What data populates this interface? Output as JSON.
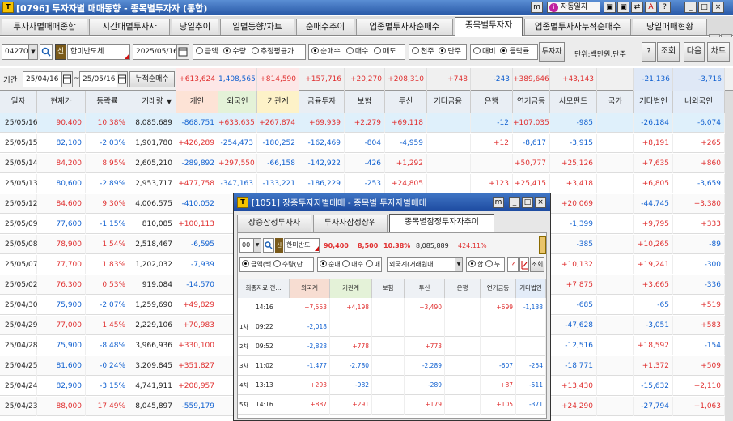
{
  "window": {
    "title": "[0796] 투자자별 매매동향 - 종목별투자자 (통합)",
    "icon": "T",
    "auto_journal": "자동일지",
    "ctrl_buttons": [
      "m",
      "▣",
      "▣",
      "⇄",
      "A",
      "?",
      "_",
      "□",
      "×"
    ]
  },
  "tabs": [
    "투자자별매매종합",
    "시간대별투자자",
    "당일추이",
    "일별동향/차트",
    "순매수추이",
    "업종별투자자순매수",
    "종목별투자자",
    "업종별투자자누적순매수",
    "당일매매현황"
  ],
  "tab_active": "종목별투자자",
  "tab_nav": [
    "◀",
    "▶"
  ],
  "toolbar": {
    "code": "042700",
    "stock_name": "한미반도체",
    "date": "2025/05/16",
    "amount_opts": [
      "금액",
      "수량",
      "추정평균가"
    ],
    "amount_sel": "수량",
    "buy_opts": [
      "순매수",
      "매수",
      "매도"
    ],
    "buy_sel": "순매수",
    "unit_opts": [
      "천주",
      "단주"
    ],
    "unit_sel": "단주",
    "cmp_opts": [
      "대비",
      "등락률"
    ],
    "cmp_sel": "등락률",
    "investor": "투자자",
    "unit_text": "단위:백만원,단주",
    "help": "?",
    "query": "조회",
    "next": "다음",
    "chart": "차트"
  },
  "period": {
    "label": "기간",
    "from": "25/04/16",
    "to": "25/05/16",
    "sep": "~",
    "accum": "누적순매수"
  },
  "summary": [
    "+613,624",
    "1,408,565",
    "+814,590",
    "+157,716",
    "+20,270",
    "+208,310",
    "+748",
    "-243",
    "+389,646",
    "+43,143",
    "",
    "-21,136",
    "-3,716"
  ],
  "headers": [
    "일자",
    "현재가",
    "등락률",
    "거래량",
    "개인",
    "외국인",
    "기관계",
    "금융투자",
    "보험",
    "투신",
    "기타금융",
    "은행",
    "연기금등",
    "사모펀드",
    "국가",
    "기타법인",
    "내외국인"
  ],
  "sort_arrow": "▼",
  "rows": [
    {
      "d": "25/05/16",
      "p": "90,400",
      "r": "10.38%",
      "v": "8,085,689",
      "c": [
        "-868,751",
        "+633,635",
        "+267,874",
        "+69,939",
        "+2,279",
        "+69,118",
        "",
        "-12",
        "+107,035",
        "-985",
        "",
        "-26,184",
        "-6,074"
      ]
    },
    {
      "d": "25/05/15",
      "p": "82,100",
      "r": "-2.03%",
      "v": "1,901,780",
      "c": [
        "+426,289",
        "-254,473",
        "-180,252",
        "-162,469",
        "-804",
        "-4,959",
        "",
        "+12",
        "-8,617",
        "-3,915",
        "",
        "+8,191",
        "+265"
      ]
    },
    {
      "d": "25/05/14",
      "p": "84,200",
      "r": "8.95%",
      "v": "2,605,210",
      "c": [
        "-289,892",
        "+297,550",
        "-66,158",
        "-142,922",
        "-426",
        "+1,292",
        "",
        "",
        "+50,777",
        "+25,126",
        "",
        "+7,635",
        "+860"
      ]
    },
    {
      "d": "25/05/13",
      "p": "80,600",
      "r": "-2.89%",
      "v": "2,953,717",
      "c": [
        "+477,758",
        "-347,163",
        "-133,221",
        "-186,229",
        "-253",
        "+24,805",
        "",
        "+123",
        "+25,415",
        "+3,418",
        "",
        "+6,805",
        "-3,659"
      ]
    },
    {
      "d": "25/05/12",
      "p": "84,600",
      "r": "9.30%",
      "v": "4,006,575",
      "c": [
        "-410,052",
        "+2",
        "",
        "",
        "",
        "",
        "",
        "",
        "",
        "+20,069",
        "",
        "-44,745",
        "+3,380"
      ]
    },
    {
      "d": "25/05/09",
      "p": "77,600",
      "r": "-1.15%",
      "v": "810,085",
      "c": [
        "+100,113",
        "",
        "",
        "",
        "",
        "",
        "",
        "",
        "",
        "-1,399",
        "",
        "+9,795",
        "+333"
      ]
    },
    {
      "d": "25/05/08",
      "p": "78,900",
      "r": "1.54%",
      "v": "2,518,467",
      "c": [
        "-6,595",
        "",
        "",
        "",
        "",
        "",
        "",
        "",
        "",
        "-385",
        "",
        "+10,265",
        "-89"
      ]
    },
    {
      "d": "25/05/07",
      "p": "77,700",
      "r": "1.83%",
      "v": "1,202,032",
      "c": [
        "-7,939",
        "",
        "",
        "",
        "",
        "",
        "",
        "",
        "",
        "+10,132",
        "",
        "+19,241",
        "-300"
      ]
    },
    {
      "d": "25/05/02",
      "p": "76,300",
      "r": "0.53%",
      "v": "919,084",
      "c": [
        "-14,570",
        "",
        "",
        "",
        "",
        "",
        "",
        "",
        "",
        "+7,875",
        "",
        "+3,665",
        "-336"
      ]
    },
    {
      "d": "25/04/30",
      "p": "75,900",
      "r": "-2.07%",
      "v": "1,259,690",
      "c": [
        "+49,829",
        "",
        "",
        "",
        "",
        "",
        "",
        "",
        "",
        "-685",
        "",
        "-65",
        "+519"
      ]
    },
    {
      "d": "25/04/29",
      "p": "77,000",
      "r": "1.45%",
      "v": "2,229,106",
      "c": [
        "+70,983",
        "",
        "",
        "",
        "",
        "",
        "",
        "",
        "",
        "-47,628",
        "",
        "-3,051",
        "+583"
      ]
    },
    {
      "d": "25/04/28",
      "p": "75,900",
      "r": "-8.48%",
      "v": "3,966,936",
      "c": [
        "+330,100",
        "",
        "",
        "",
        "",
        "",
        "",
        "",
        "",
        "-12,516",
        "",
        "+18,592",
        "-154"
      ]
    },
    {
      "d": "25/04/25",
      "p": "81,600",
      "r": "-0.24%",
      "v": "3,209,845",
      "c": [
        "+351,827",
        "",
        "",
        "",
        "",
        "",
        "",
        "",
        "",
        "-18,771",
        "",
        "+1,372",
        "+509"
      ]
    },
    {
      "d": "25/04/24",
      "p": "82,900",
      "r": "-3.15%",
      "v": "4,741,911",
      "c": [
        "+208,957",
        "",
        "",
        "",
        "",
        "",
        "",
        "",
        "",
        "+13,430",
        "",
        "-15,632",
        "+2,110"
      ]
    },
    {
      "d": "25/04/23",
      "p": "88,000",
      "r": "17.49%",
      "v": "8,045,897",
      "c": [
        "-559,179",
        "",
        "",
        "",
        "",
        "",
        "",
        "",
        "",
        "+24,290",
        "",
        "-27,794",
        "+1,063"
      ]
    }
  ],
  "popup": {
    "title": "[1051] 장중투자자별매매 - 종목별 투자자별매매",
    "icon": "T",
    "buttons": [
      "m",
      "_",
      "□",
      "×"
    ],
    "tabs": [
      "장중잠정투자자",
      "투자자잠정상위",
      "종목별잠정투자자추이"
    ],
    "tab_active": "종목별잠정투자자추이",
    "code": "00",
    "stock": "한미반도",
    "price": "90,400",
    "change": "8,500",
    "rate": "10.38%",
    "volume": "8,085,889",
    "ratio": "424.11%",
    "amt_opts": [
      "금액(백",
      "수량(단"
    ],
    "buy_opts": [
      "순매",
      "매수",
      "매"
    ],
    "foreign": "외국계(거래원매",
    "nocap": [
      "합",
      "누"
    ],
    "query": "조회",
    "header": [
      "최종자료 전...",
      "외국계",
      "기관계",
      "보험",
      "투신",
      "은행",
      "연기금등",
      "기타법인"
    ],
    "rows": [
      {
        "t": "",
        "time": "14:16",
        "v": [
          "+7,553",
          "+4,198",
          "",
          "+3,490",
          "",
          "+699",
          "-1,138"
        ]
      },
      {
        "t": "1차",
        "time": "09:22",
        "v": [
          "-2,018",
          "",
          "",
          "",
          "",
          "",
          ""
        ]
      },
      {
        "t": "2차",
        "time": "09:52",
        "v": [
          "-2,828",
          "+778",
          "",
          "+773",
          "",
          "",
          ""
        ]
      },
      {
        "t": "3차",
        "time": "11:02",
        "v": [
          "-1,477",
          "-2,780",
          "",
          "-2,289",
          "",
          "-607",
          "-254"
        ]
      },
      {
        "t": "4차",
        "time": "13:13",
        "v": [
          "+293",
          "-982",
          "",
          "-289",
          "",
          "+87",
          "-511"
        ]
      },
      {
        "t": "5차",
        "time": "14:16",
        "v": [
          "+887",
          "+291",
          "",
          "+179",
          "",
          "+105",
          "-371"
        ]
      }
    ]
  }
}
